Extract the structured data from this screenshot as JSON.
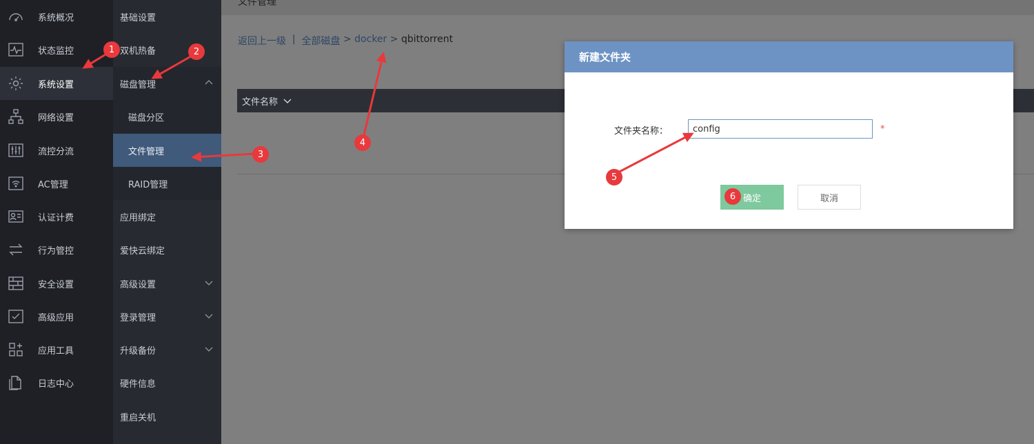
{
  "nav_primary": [
    {
      "label": "系统概况",
      "icon": "dashboard-icon"
    },
    {
      "label": "状态监控",
      "icon": "monitor-icon"
    },
    {
      "label": "系统设置",
      "icon": "gear-icon",
      "active": true
    },
    {
      "label": "网络设置",
      "icon": "network-icon"
    },
    {
      "label": "流控分流",
      "icon": "sliders-icon"
    },
    {
      "label": "AC管理",
      "icon": "wifi-icon"
    },
    {
      "label": "认证计费",
      "icon": "id-card-icon"
    },
    {
      "label": "行为管控",
      "icon": "arrows-icon"
    },
    {
      "label": "安全设置",
      "icon": "firewall-icon"
    },
    {
      "label": "高级应用",
      "icon": "checklist-icon"
    },
    {
      "label": "应用工具",
      "icon": "apps-icon"
    },
    {
      "label": "日志中心",
      "icon": "log-icon"
    }
  ],
  "nav_secondary": [
    {
      "label": "基础设置"
    },
    {
      "label": "双机热备"
    },
    {
      "label": "磁盘管理",
      "expanded": true
    },
    {
      "label": "磁盘分区",
      "sub": true
    },
    {
      "label": "文件管理",
      "sub": true,
      "active": true
    },
    {
      "label": "RAID管理",
      "sub": true
    },
    {
      "label": "应用绑定"
    },
    {
      "label": "爱快云绑定"
    },
    {
      "label": "高级设置",
      "collapsible": true
    },
    {
      "label": "登录管理",
      "collapsible": true
    },
    {
      "label": "升级备份",
      "collapsible": true
    },
    {
      "label": "硬件信息"
    },
    {
      "label": "重启关机"
    }
  ],
  "page": {
    "title": "文件管理",
    "breadcrumb": {
      "back": "返回上一级",
      "sep": "|",
      "root": "全部磁盘",
      "arrow": ">",
      "folder1": "docker",
      "current": "qbittorrent"
    },
    "table": {
      "col_name": "文件名称"
    }
  },
  "dialog": {
    "title": "新建文件夹",
    "field_label": "文件夹名称：",
    "field_value": "config",
    "required_mark": "*",
    "ok_label": "确定",
    "cancel_label": "取消"
  },
  "annotations": {
    "badges": [
      "1",
      "2",
      "3",
      "4",
      "5",
      "6"
    ],
    "color": "#e8393c"
  },
  "colors": {
    "sidebar_bg": "#1e2026",
    "submenu_bg": "#272a31",
    "active_item": "#3f5a7a",
    "dialog_header": "#6d93c4",
    "ok_button": "#7ec99d"
  }
}
